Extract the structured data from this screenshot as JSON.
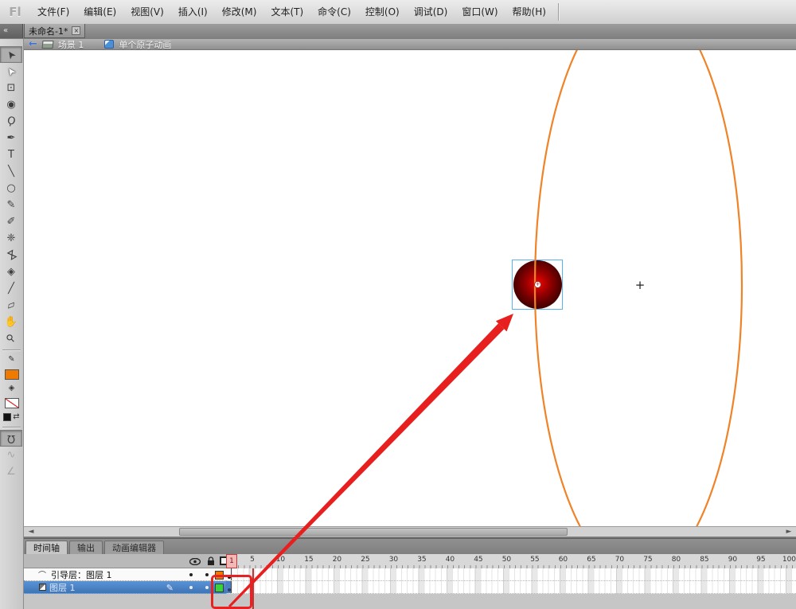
{
  "app": {
    "logo": "Fl"
  },
  "menu_bar": {
    "items": [
      "文件(F)",
      "编辑(E)",
      "视图(V)",
      "插入(I)",
      "修改(M)",
      "文本(T)",
      "命令(C)",
      "控制(O)",
      "调试(D)",
      "窗口(W)",
      "帮助(H)"
    ]
  },
  "document_tabs": {
    "collapse_button": "«",
    "active_tab": {
      "label": "未命名-1*",
      "close_glyph": "×"
    }
  },
  "edit_bar": {
    "back_glyph": "←",
    "scene_label": "场景 1",
    "symbol_label": "单个原子动画"
  },
  "toolbar": {
    "tools": [
      {
        "name": "selection-tool",
        "glyph": "➤",
        "rotate": -125,
        "selected": true
      },
      {
        "name": "subselection-tool",
        "glyph": "➤",
        "rotate": -125,
        "white": true
      },
      {
        "name": "free-transform-tool",
        "glyph": "⊡",
        "rotate": 0
      },
      {
        "name": "3d-rotation-tool",
        "glyph": "◉",
        "rotate": 0
      },
      {
        "name": "lasso-tool",
        "glyph": "Ϙ",
        "rotate": 15
      },
      {
        "name": "pen-tool",
        "glyph": "✒",
        "rotate": 0
      },
      {
        "name": "text-tool",
        "glyph": "T",
        "rotate": 0
      },
      {
        "name": "line-tool",
        "glyph": "╲",
        "rotate": 0
      },
      {
        "name": "oval-tool",
        "glyph": "○",
        "rotate": 0
      },
      {
        "name": "pencil-tool",
        "glyph": "✎",
        "rotate": 0
      },
      {
        "name": "brush-tool",
        "glyph": "✐",
        "rotate": 0
      },
      {
        "name": "deco-tool",
        "glyph": "❈",
        "rotate": 0
      },
      {
        "name": "bone-tool",
        "glyph": "⋈",
        "rotate": 60
      },
      {
        "name": "paint-bucket-tool",
        "glyph": "◈",
        "rotate": 0
      },
      {
        "name": "eyedropper-tool",
        "glyph": "╱",
        "rotate": 0
      },
      {
        "name": "eraser-tool",
        "glyph": "▱",
        "rotate": -20
      },
      {
        "name": "hand-tool",
        "glyph": "✋",
        "rotate": 0
      },
      {
        "name": "zoom-tool",
        "glyph": "⚲",
        "rotate": -45
      }
    ],
    "stroke_pencil_glyph": "✎",
    "fill_bucket_glyph": "◈",
    "stroke_color": "#F07A00",
    "swap_glyph": "⇄",
    "options": [
      {
        "name": "snap-to-objects-option",
        "glyph": "Ω",
        "rotate": 180,
        "pressed": true
      },
      {
        "name": "smooth-option",
        "glyph": "∿",
        "rotate": 0,
        "disabled": true
      },
      {
        "name": "straighten-option",
        "glyph": "∠",
        "rotate": 0,
        "disabled": true
      }
    ]
  },
  "stage": {
    "path_color": "#F08328",
    "selection_color": "#56B3EF",
    "crosshair_glyph": "+",
    "transform_point_glyph": "+"
  },
  "scrollbar": {
    "left_glyph": "◄",
    "right_glyph": "►"
  },
  "timeline": {
    "tabs": [
      {
        "label": "时间轴",
        "active": true
      },
      {
        "label": "输出",
        "active": false
      },
      {
        "label": "动画编辑器",
        "active": false
      }
    ],
    "ruler": {
      "playhead_frame": "1",
      "labels": [
        5,
        10,
        15,
        20,
        25,
        30,
        35,
        40,
        45,
        50,
        55,
        60,
        65,
        70,
        75,
        80,
        85,
        90,
        95,
        100
      ]
    },
    "layers": [
      {
        "name": "引导层：图层 1",
        "type": "guide",
        "type_glyph": "⌒",
        "swatch": "#F07A00",
        "selected": false
      },
      {
        "name": "图层 1",
        "type": "normal",
        "type_glyph": "",
        "swatch": "#3BD33B",
        "selected": true,
        "pencil_glyph": "✎"
      }
    ]
  },
  "annotations": {
    "color": "#E62222"
  }
}
